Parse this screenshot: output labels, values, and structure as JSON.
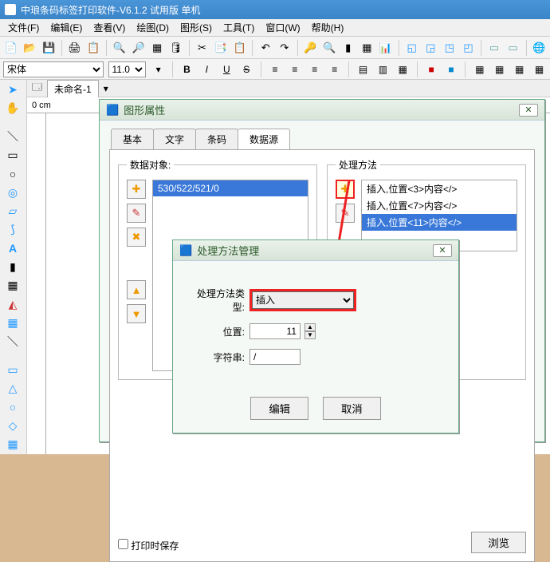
{
  "app": {
    "title": "中琅条码标签打印软件-V6.1.2 试用版 单机"
  },
  "menu": {
    "file": "文件(F)",
    "edit": "编辑(E)",
    "view": "查看(V)",
    "draw": "绘图(D)",
    "shape": "图形(S)",
    "tool": "工具(T)",
    "window": "窗口(W)",
    "help": "帮助(H)"
  },
  "fontbar": {
    "font": "宋体",
    "size": "11.0"
  },
  "doc": {
    "tabname": "未命名-1",
    "ruler0": "0 cm"
  },
  "modal1": {
    "title": "图形属性",
    "tabs": {
      "basic": "基本",
      "text": "文字",
      "barcode": "条码",
      "datasource": "数据源"
    },
    "grp_obj": "数据对象:",
    "obj_val": "530/522/521/0",
    "grp_method": "处理方法",
    "methods": [
      "插入,位置<3>内容</>",
      "插入,位置<7>内容</>",
      "插入,位置<11>内容</>"
    ],
    "print_chk": "打印时保存",
    "browse": "浏览"
  },
  "modal2": {
    "title": "处理方法管理",
    "type_label": "处理方法类型:",
    "type_value": "插入",
    "pos_label": "位置:",
    "pos_value": "11",
    "str_label": "字符串:",
    "str_value": "/",
    "btn_edit": "编辑",
    "btn_cancel": "取消"
  }
}
